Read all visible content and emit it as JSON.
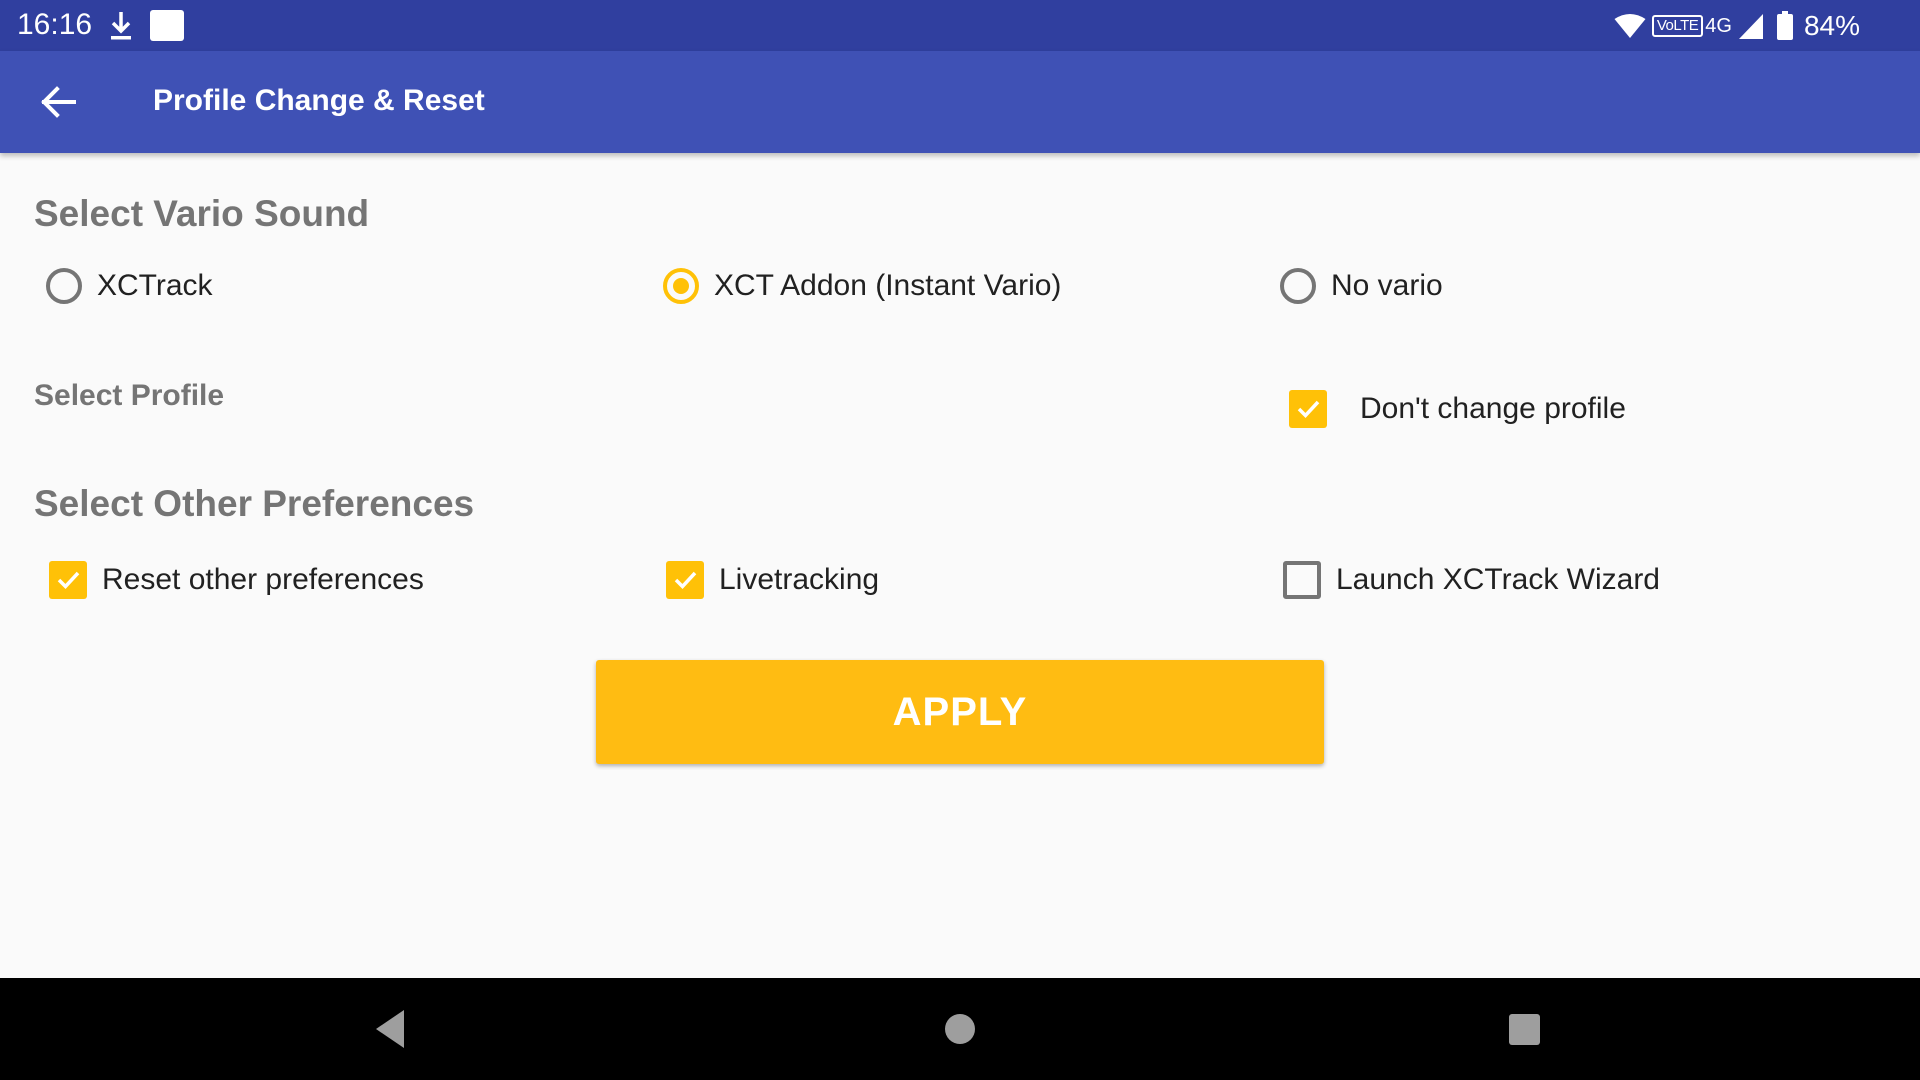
{
  "status_bar": {
    "time": "16:16",
    "icons": [
      "download-icon",
      "notification-square-icon",
      "wifi-icon",
      "volte-icon",
      "signal-icon",
      "battery-icon"
    ],
    "volte_label": "VoLTE",
    "network_type": "4G",
    "battery_percent": "84%"
  },
  "app_bar": {
    "back_icon": "arrow-left-icon",
    "title": "Profile Change & Reset",
    "color": "#3f51b5"
  },
  "vario": {
    "title": "Select Vario Sound",
    "options": [
      {
        "label": "XCTrack",
        "selected": false
      },
      {
        "label": "XCT Addon (Instant Vario)",
        "selected": true
      },
      {
        "label": "No vario",
        "selected": false
      }
    ]
  },
  "profile": {
    "title": "Select Profile",
    "dont_change_label": "Don't change profile",
    "dont_change_checked": true
  },
  "preferences": {
    "title": "Select Other Preferences",
    "options": [
      {
        "label": "Reset other preferences",
        "checked": true
      },
      {
        "label": "Livetracking",
        "checked": true
      },
      {
        "label": "Launch XCTrack Wizard",
        "checked": false
      }
    ]
  },
  "apply_button": {
    "label": "APPLY",
    "color": "#ffbc12"
  },
  "nav_bar": {
    "icons": [
      "nav-back-icon",
      "nav-home-icon",
      "nav-recents-icon"
    ]
  },
  "colors": {
    "accent": "#ffc107",
    "status_bar": "#303f9f",
    "section_text": "#757575"
  }
}
